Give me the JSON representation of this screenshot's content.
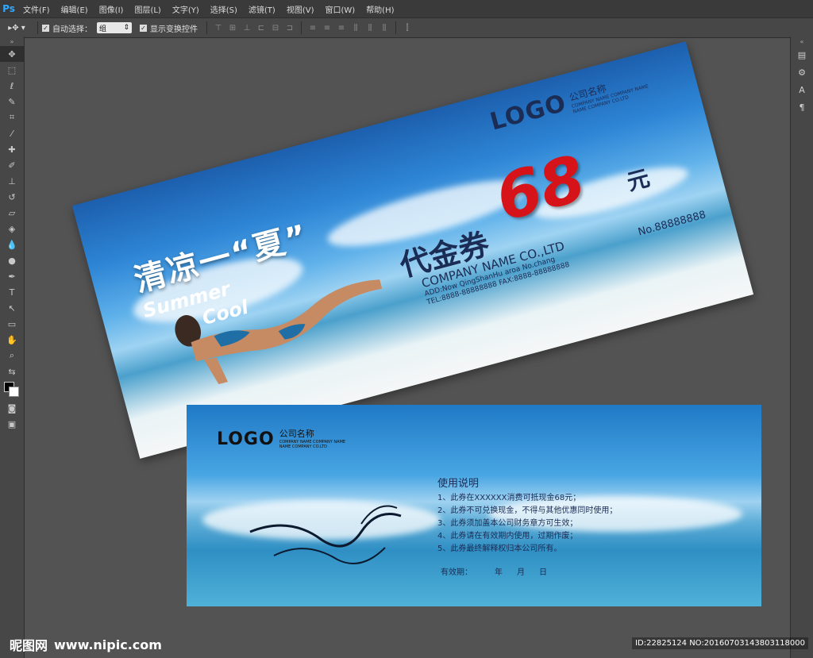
{
  "app": {
    "logo": "Ps"
  },
  "menu": [
    "文件(F)",
    "编辑(E)",
    "图像(I)",
    "图层(L)",
    "文字(Y)",
    "选择(S)",
    "滤镜(T)",
    "视图(V)",
    "窗口(W)",
    "帮助(H)"
  ],
  "options": {
    "auto_select_label": "自动选择：",
    "auto_select_value": "组",
    "show_transform_label": "显示变换控件"
  },
  "front_card": {
    "logo": "LOGO",
    "company_cn": "公司名称",
    "company_en_line1": "COMPANY NAME COMPANY NAME",
    "company_en_line2": "NAME COMPANY CO.LTD",
    "title_cn": "清凉一“夏”",
    "title_en1": "Summer",
    "title_en2": "Cool",
    "voucher": "代金券",
    "amount": "68",
    "unit": "元",
    "company_name": "COMPANY NAME CO.,LTD",
    "address": "ADD:Now QingShanHu aroa No.chang",
    "tel": "TEL:8888-88888888  FAX:8888-88888888",
    "serial": "No.88888888"
  },
  "back_card": {
    "logo": "LOGO",
    "company_cn": "公司名称",
    "company_en_line1": "COMPANY NAME COMPANY NAME",
    "company_en_line2": "NAME COMPANY CO.LTD",
    "rules_title": "使用说明",
    "rules": [
      "1、此券在XXXXXX消费可抵现金68元；",
      "2、此券不可兑换现金，不得与其他优惠同时使用；",
      "3、此券须加盖本公司财务章方可生效；",
      "4、此券请在有效期内使用，过期作废；",
      "5、此券最终解释权归本公司所有。"
    ],
    "validity_label": "有效期：",
    "year": "年",
    "month": "月",
    "day": "日"
  },
  "footer": {
    "site_cn": "昵图网",
    "site_url": "www.nipic.com",
    "id_text": "ID:22825124 NO:20160703143803118000"
  }
}
